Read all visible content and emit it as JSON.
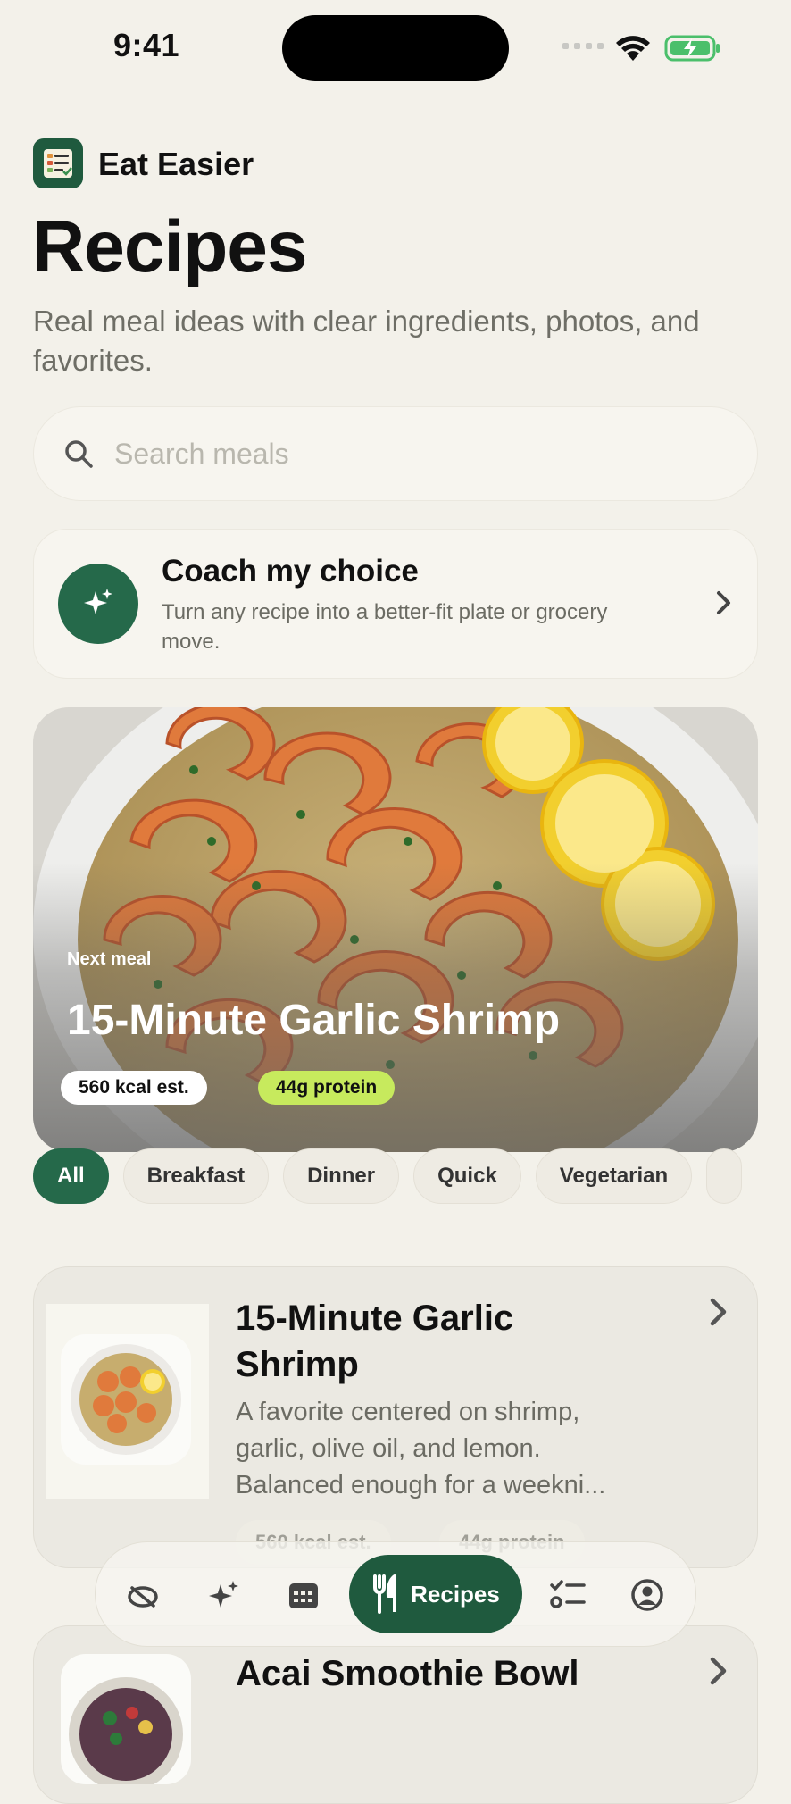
{
  "status_bar": {
    "time": "9:41"
  },
  "header": {
    "app_name": "Eat Easier",
    "title": "Recipes",
    "subtitle": "Real meal ideas with clear ingredients, photos, and favorites."
  },
  "search": {
    "placeholder": "Search meals",
    "value": ""
  },
  "coach": {
    "title": "Coach my choice",
    "description": "Turn any recipe into a better-fit plate or grocery move."
  },
  "hero": {
    "kicker": "Next meal",
    "title": "15-Minute Garlic Shrimp",
    "kcal": "560 kcal est.",
    "protein": "44g protein"
  },
  "filters": {
    "active": "All",
    "chips": [
      "All",
      "Breakfast",
      "Dinner",
      "Quick",
      "Vegetarian"
    ]
  },
  "recipes": [
    {
      "title": "15-Minute Garlic Shrimp",
      "description": "A favorite centered on shrimp, garlic, olive oil, and lemon. Balanced enough for a weekni...",
      "kcal": "560 kcal est.",
      "protein": "44g protein"
    },
    {
      "title": "Acai Smoothie Bowl"
    }
  ],
  "tabbar": {
    "active_label": "Recipes",
    "icons": [
      "food-scan-icon",
      "sparkle-icon",
      "calendar-icon",
      "fork-knife-icon",
      "checklist-icon",
      "profile-icon"
    ]
  },
  "colors": {
    "accent_green": "#25694a",
    "protein_pill": "#c7ea5d",
    "background": "#f3f1ea"
  }
}
